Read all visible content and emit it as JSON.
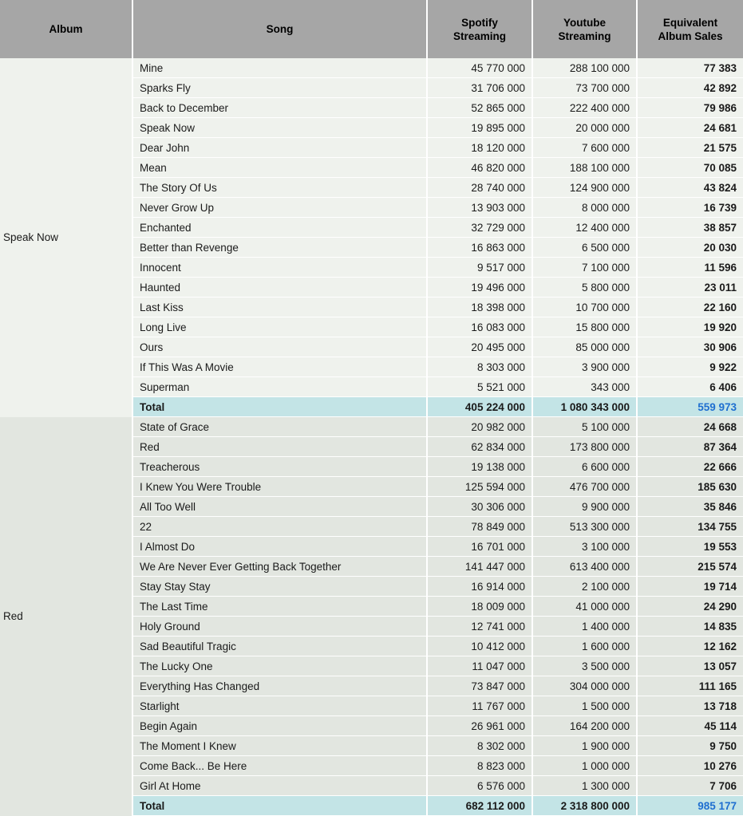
{
  "table": {
    "headers": {
      "album": "Album",
      "song": "Song",
      "spotify": "Spotify\nStreaming",
      "spotify_line1": "Spotify",
      "spotify_line2": "Streaming",
      "youtube_line1": "Youtube",
      "youtube_line2": "Streaming",
      "equivalent_line1": "Equivalent",
      "equivalent_line2": "Album Sales"
    },
    "total_label": "Total",
    "colors": {
      "header_bg": "#a6a6a6",
      "group_a_bg": "#eff2ed",
      "group_b_bg": "#e2e6e0",
      "total_bg": "#c3e4e6",
      "total_eq_text": "#1f6fd0",
      "grid": "#ffffff"
    },
    "groups": [
      {
        "album": "Speak Now",
        "rows": [
          {
            "song": "Mine",
            "spotify": "45 770 000",
            "youtube": "288 100 000",
            "equivalent": "77 383"
          },
          {
            "song": "Sparks Fly",
            "spotify": "31 706 000",
            "youtube": "73 700 000",
            "equivalent": "42 892"
          },
          {
            "song": "Back to December",
            "spotify": "52 865 000",
            "youtube": "222 400 000",
            "equivalent": "79 986"
          },
          {
            "song": "Speak Now",
            "spotify": "19 895 000",
            "youtube": "20 000 000",
            "equivalent": "24 681"
          },
          {
            "song": "Dear John",
            "spotify": "18 120 000",
            "youtube": "7 600 000",
            "equivalent": "21 575"
          },
          {
            "song": "Mean",
            "spotify": "46 820 000",
            "youtube": "188 100 000",
            "equivalent": "70 085"
          },
          {
            "song": "The Story Of Us",
            "spotify": "28 740 000",
            "youtube": "124 900 000",
            "equivalent": "43 824"
          },
          {
            "song": "Never Grow Up",
            "spotify": "13 903 000",
            "youtube": "8 000 000",
            "equivalent": "16 739"
          },
          {
            "song": "Enchanted",
            "spotify": "32 729 000",
            "youtube": "12 400 000",
            "equivalent": "38 857"
          },
          {
            "song": "Better than Revenge",
            "spotify": "16 863 000",
            "youtube": "6 500 000",
            "equivalent": "20 030"
          },
          {
            "song": "Innocent",
            "spotify": "9 517 000",
            "youtube": "7 100 000",
            "equivalent": "11 596"
          },
          {
            "song": "Haunted",
            "spotify": "19 496 000",
            "youtube": "5 800 000",
            "equivalent": "23 011"
          },
          {
            "song": "Last Kiss",
            "spotify": "18 398 000",
            "youtube": "10 700 000",
            "equivalent": "22 160"
          },
          {
            "song": "Long Live",
            "spotify": "16 083 000",
            "youtube": "15 800 000",
            "equivalent": "19 920"
          },
          {
            "song": "Ours",
            "spotify": "20 495 000",
            "youtube": "85 000 000",
            "equivalent": "30 906"
          },
          {
            "song": "If This Was A Movie",
            "spotify": "8 303 000",
            "youtube": "3 900 000",
            "equivalent": "9 922"
          },
          {
            "song": "Superman",
            "spotify": "5 521 000",
            "youtube": "343 000",
            "equivalent": "6 406"
          }
        ],
        "total": {
          "song": "Total",
          "spotify": "405 224 000",
          "youtube": "1 080 343 000",
          "equivalent": "559 973"
        }
      },
      {
        "album": "Red",
        "rows": [
          {
            "song": "State of Grace",
            "spotify": "20 982 000",
            "youtube": "5 100 000",
            "equivalent": "24 668"
          },
          {
            "song": "Red",
            "spotify": "62 834 000",
            "youtube": "173 800 000",
            "equivalent": "87 364"
          },
          {
            "song": "Treacherous",
            "spotify": "19 138 000",
            "youtube": "6 600 000",
            "equivalent": "22 666"
          },
          {
            "song": "I Knew You Were Trouble",
            "spotify": "125 594 000",
            "youtube": "476 700 000",
            "equivalent": "185 630"
          },
          {
            "song": "All Too Well",
            "spotify": "30 306 000",
            "youtube": "9 900 000",
            "equivalent": "35 846"
          },
          {
            "song": "22",
            "spotify": "78 849 000",
            "youtube": "513 300 000",
            "equivalent": "134 755"
          },
          {
            "song": "I Almost Do",
            "spotify": "16 701 000",
            "youtube": "3 100 000",
            "equivalent": "19 553"
          },
          {
            "song": "We Are Never Ever Getting Back Together",
            "spotify": "141 447 000",
            "youtube": "613 400 000",
            "equivalent": "215 574"
          },
          {
            "song": "Stay Stay Stay",
            "spotify": "16 914 000",
            "youtube": "2 100 000",
            "equivalent": "19 714"
          },
          {
            "song": "The Last Time",
            "spotify": "18 009 000",
            "youtube": "41 000 000",
            "equivalent": "24 290"
          },
          {
            "song": "Holy Ground",
            "spotify": "12 741 000",
            "youtube": "1 400 000",
            "equivalent": "14 835"
          },
          {
            "song": "Sad Beautiful Tragic",
            "spotify": "10 412 000",
            "youtube": "1 600 000",
            "equivalent": "12 162"
          },
          {
            "song": "The Lucky One",
            "spotify": "11 047 000",
            "youtube": "3 500 000",
            "equivalent": "13 057"
          },
          {
            "song": "Everything Has Changed",
            "spotify": "73 847 000",
            "youtube": "304 000 000",
            "equivalent": "111 165"
          },
          {
            "song": "Starlight",
            "spotify": "11 767 000",
            "youtube": "1 500 000",
            "equivalent": "13 718"
          },
          {
            "song": "Begin Again",
            "spotify": "26 961 000",
            "youtube": "164 200 000",
            "equivalent": "45 114"
          },
          {
            "song": "The Moment I Knew",
            "spotify": "8 302 000",
            "youtube": "1 900 000",
            "equivalent": "9 750"
          },
          {
            "song": "Come Back... Be Here",
            "spotify": "8 823 000",
            "youtube": "1 000 000",
            "equivalent": "10 276"
          },
          {
            "song": "Girl At Home",
            "spotify": "6 576 000",
            "youtube": "1 300 000",
            "equivalent": "7 706"
          }
        ],
        "total": {
          "song": "Total",
          "spotify": "682 112 000",
          "youtube": "2 318 800 000",
          "equivalent": "985 177"
        }
      }
    ]
  }
}
